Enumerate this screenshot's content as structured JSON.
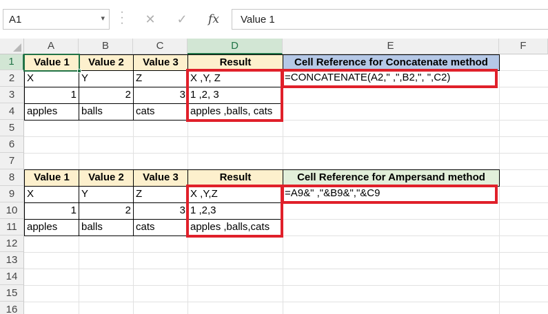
{
  "formula_bar": {
    "name_box": "A1",
    "cancel_icon": "✕",
    "enter_icon": "✓",
    "fx_label": "fx",
    "formula": "Value 1"
  },
  "columns": [
    "A",
    "B",
    "C",
    "D",
    "E",
    "F"
  ],
  "rows": [
    "1",
    "2",
    "3",
    "4",
    "5",
    "6",
    "7",
    "8",
    "9",
    "10",
    "11",
    "12",
    "13",
    "14",
    "15",
    "16"
  ],
  "table1": {
    "headers": [
      "Value 1",
      "Value 2",
      "Value 3",
      "Result"
    ],
    "note_header": "Cell Reference for Concatenate method",
    "rows": [
      [
        "X",
        "Y",
        "Z",
        "X ,Y, Z"
      ],
      [
        "1",
        "2",
        "3",
        "1 ,2, 3"
      ],
      [
        "apples",
        "balls",
        "cats",
        "apples ,balls, cats"
      ]
    ],
    "formula": "=CONCATENATE(A2,\" ,\",B2,\", \",C2)"
  },
  "table2": {
    "headers": [
      "Value 1",
      "Value 2",
      "Value 3",
      "Result"
    ],
    "note_header": "Cell Reference for Ampersand method",
    "rows": [
      [
        "X",
        "Y",
        "Z",
        "X ,Y,Z"
      ],
      [
        "1",
        "2",
        "3",
        "1 ,2,3"
      ],
      [
        "apples",
        "balls",
        "cats",
        "apples ,balls,cats"
      ]
    ],
    "formula": "=A9&\" ,\"&B9&\",\"&C9"
  },
  "colors": {
    "header_fill": "#fdf0cd",
    "concat_header_fill": "#b5c8e6",
    "amp_header_fill": "#e2efda",
    "highlight_outline": "#e0202a",
    "selection": "#217346"
  }
}
